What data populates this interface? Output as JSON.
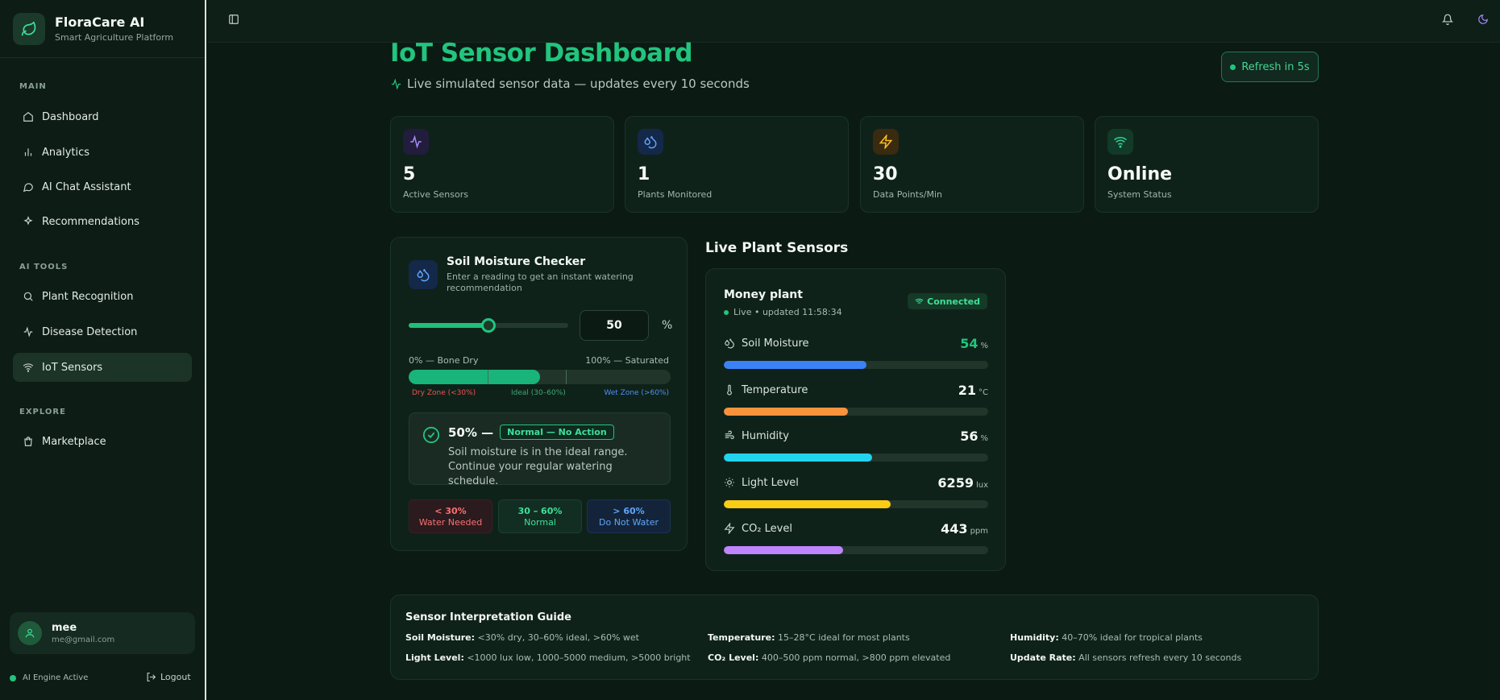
{
  "brand": {
    "title": "FloraCare AI",
    "subtitle": "Smart Agriculture Platform"
  },
  "nav": {
    "main_label": "MAIN",
    "main": [
      "Dashboard",
      "Analytics",
      "AI Chat Assistant",
      "Recommendations"
    ],
    "tools_label": "AI TOOLS",
    "tools": [
      "Plant Recognition",
      "Disease Detection",
      "IoT Sensors"
    ],
    "explore_label": "EXPLORE",
    "explore": [
      "Marketplace"
    ]
  },
  "user": {
    "name": "mee",
    "email": "me@gmail.com"
  },
  "footer": {
    "engine": "AI Engine Active",
    "logout": "Logout"
  },
  "page": {
    "title": "IoT Sensor Dashboard",
    "subtitle": "Live simulated sensor data — updates every 10 seconds",
    "refresh": "Refresh in 5s"
  },
  "stats": [
    {
      "value": "5",
      "label": "Active Sensors",
      "color": "#a78bfa"
    },
    {
      "value": "1",
      "label": "Plants Monitored",
      "color": "#60a5fa"
    },
    {
      "value": "30",
      "label": "Data Points/Min",
      "color": "#fbbf24"
    },
    {
      "value": "Online",
      "label": "System Status",
      "color": "#34d399"
    }
  ],
  "soil_checker": {
    "title": "Soil Moisture Checker",
    "description": "Enter a reading to get an instant watering recommendation",
    "value": "50",
    "unit": "%",
    "slider_level": 0.5,
    "scale_min": "0% — Bone Dry",
    "scale_max": "100% — Saturated",
    "zones": {
      "dry": "Dry Zone (<30%)",
      "ideal": "Ideal (30–60%)",
      "wet": "Wet Zone (>60%)"
    },
    "result_value": "50% —",
    "result_badge": "Normal — No Action",
    "result_text": "Soil moisture is in the ideal range. Continue your regular watering schedule.",
    "legend": [
      {
        "range": "< 30%",
        "label": "Water Needed"
      },
      {
        "range": "30 – 60%",
        "label": "Normal"
      },
      {
        "range": "> 60%",
        "label": "Do Not Water"
      }
    ]
  },
  "live_sensors": {
    "section_title": "Live Plant Sensors",
    "plant_name": "Money plant",
    "status": "Live • updated 11:58:34",
    "connection": "Connected",
    "sensors": [
      {
        "name": "Soil Moisture",
        "value": "54",
        "unit": "%",
        "level": 0.54,
        "color": "#3b82f6"
      },
      {
        "name": "Temperature",
        "value": "21",
        "unit": "°C",
        "level": 0.47,
        "color": "#fb923c"
      },
      {
        "name": "Humidity",
        "value": "56",
        "unit": "%",
        "level": 0.56,
        "color": "#22d3ee"
      },
      {
        "name": "Light Level",
        "value": "6259",
        "unit": "lux",
        "level": 0.63,
        "color": "#facc15"
      },
      {
        "name": "CO₂ Level",
        "value": "443",
        "unit": "ppm",
        "level": 0.45,
        "color": "#c084fc"
      }
    ]
  },
  "guide": {
    "title": "Sensor Interpretation Guide",
    "items": [
      {
        "k": "Soil Moisture:",
        "v": "<30% dry, 30–60% ideal, >60% wet"
      },
      {
        "k": "Temperature:",
        "v": "15–28°C ideal for most plants"
      },
      {
        "k": "Humidity:",
        "v": "40–70% ideal for tropical plants"
      },
      {
        "k": "Light Level:",
        "v": "<1000 lux low, 1000–5000 medium, >5000 bright"
      },
      {
        "k": "CO₂ Level:",
        "v": "400–500 ppm normal, >800 ppm elevated"
      },
      {
        "k": "Update Rate:",
        "v": "All sensors refresh every 10 seconds"
      }
    ]
  }
}
